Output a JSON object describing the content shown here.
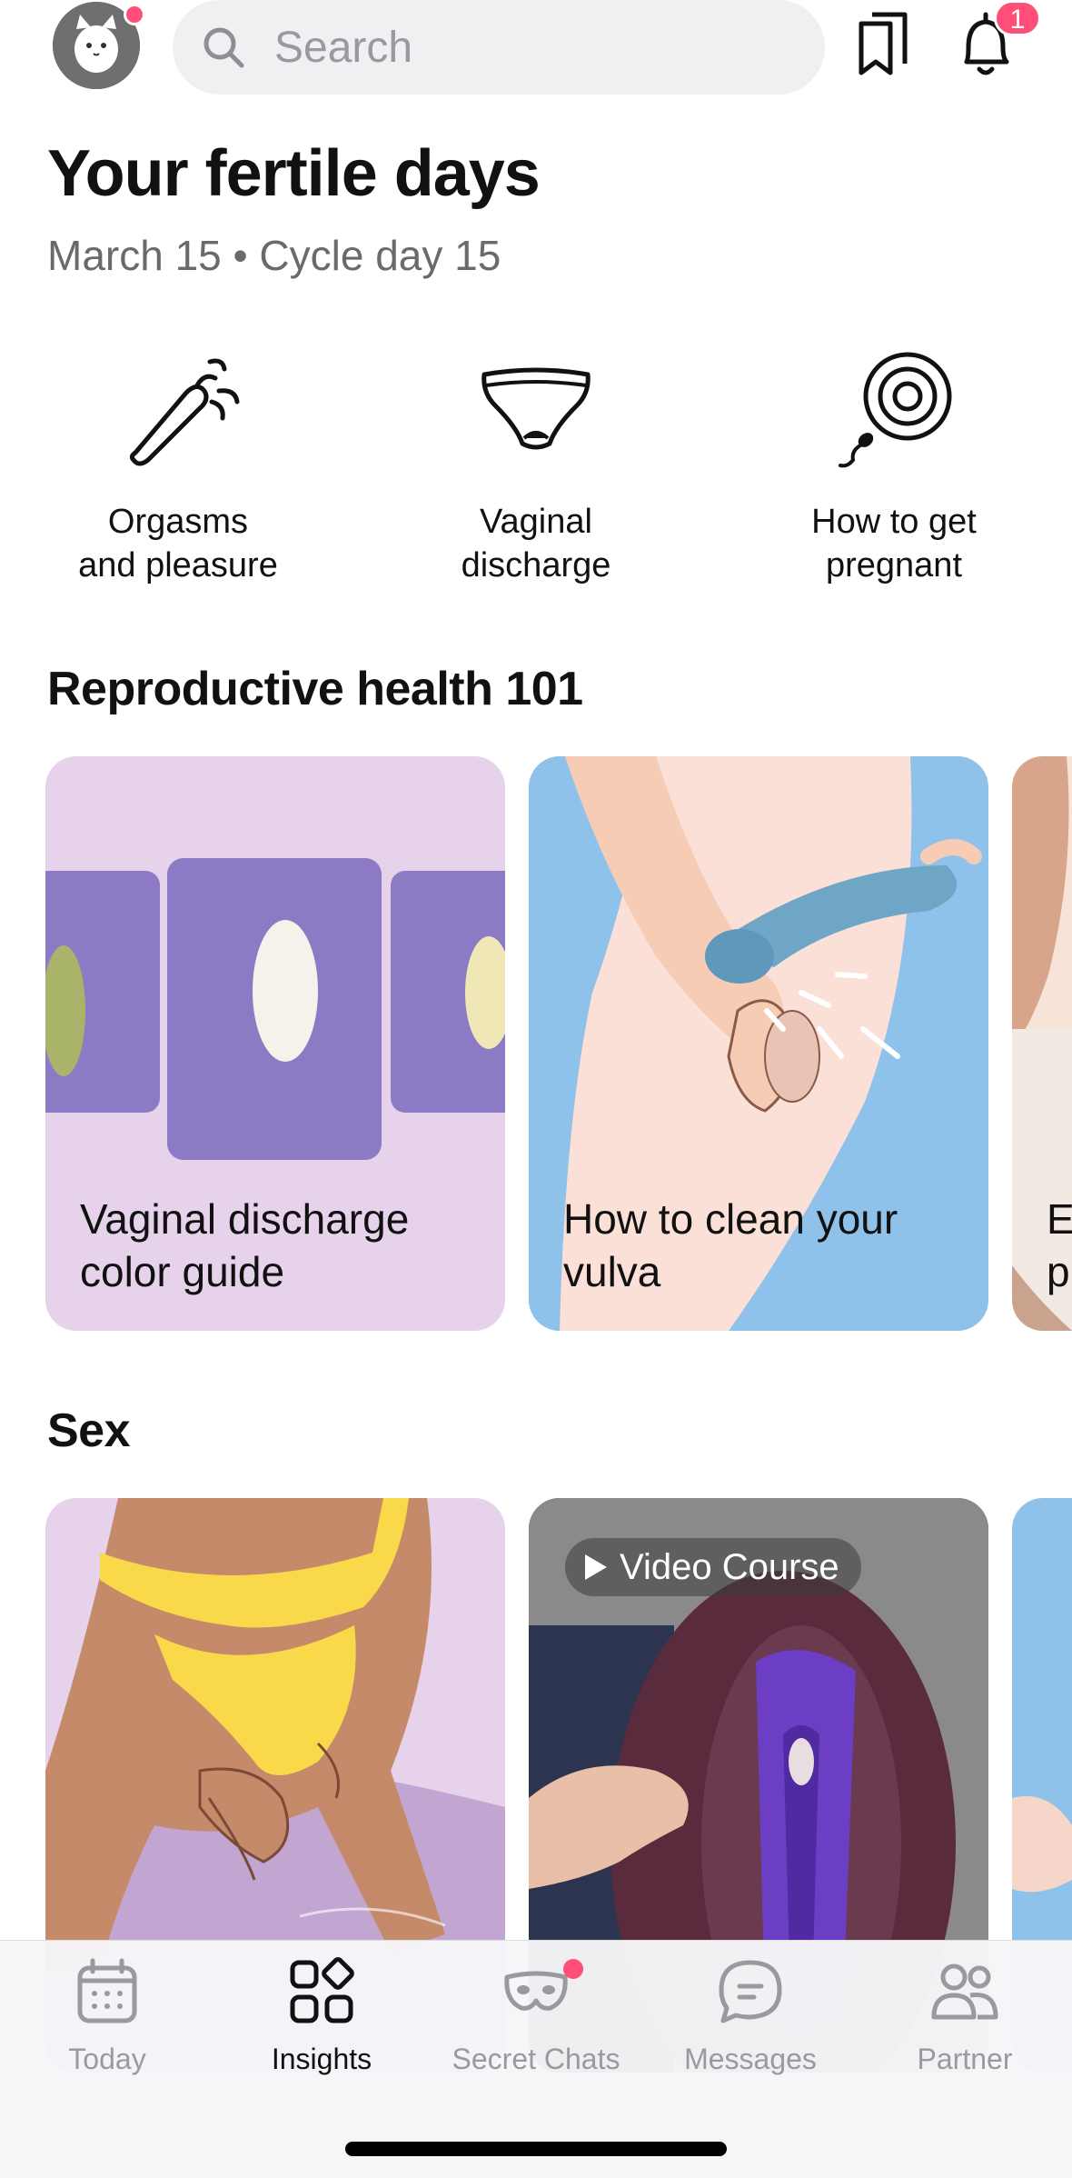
{
  "header": {
    "search_placeholder": "Search",
    "notification_count": "1"
  },
  "hero": {
    "title": "Your fertile days",
    "date": "March 15",
    "separator": "•",
    "cycle_day": "Cycle day 15"
  },
  "topics": [
    {
      "line1": "Orgasms",
      "line2": "and pleasure",
      "icon": "vibrator-icon"
    },
    {
      "line1": "Vaginal",
      "line2": "discharge",
      "icon": "underwear-icon"
    },
    {
      "line1": "How to get",
      "line2": "pregnant",
      "icon": "egg-sperm-icon"
    }
  ],
  "sections": {
    "reproductive": {
      "title": "Reproductive health 101",
      "cards": [
        {
          "line1": "Vaginal discharge",
          "line2": "color guide"
        },
        {
          "line1": "How to clean your",
          "line2": "vulva"
        },
        {
          "line1": "E",
          "line2": "p"
        }
      ]
    },
    "sex": {
      "title": "Sex",
      "video_badge": "Video Course"
    }
  },
  "tabbar": {
    "tabs": [
      {
        "label": "Today",
        "icon": "calendar-icon"
      },
      {
        "label": "Insights",
        "icon": "grid-icon"
      },
      {
        "label": "Secret Chats",
        "icon": "mask-icon"
      },
      {
        "label": "Messages",
        "icon": "chat-bubble-icon"
      },
      {
        "label": "Partner",
        "icon": "people-icon"
      }
    ],
    "active": "Insights"
  },
  "colors": {
    "accent": "#ff4f79",
    "card_lilac": "#e6d2ea",
    "card_peach": "#fbe0d8",
    "card_blue": "#8fc2ea"
  }
}
